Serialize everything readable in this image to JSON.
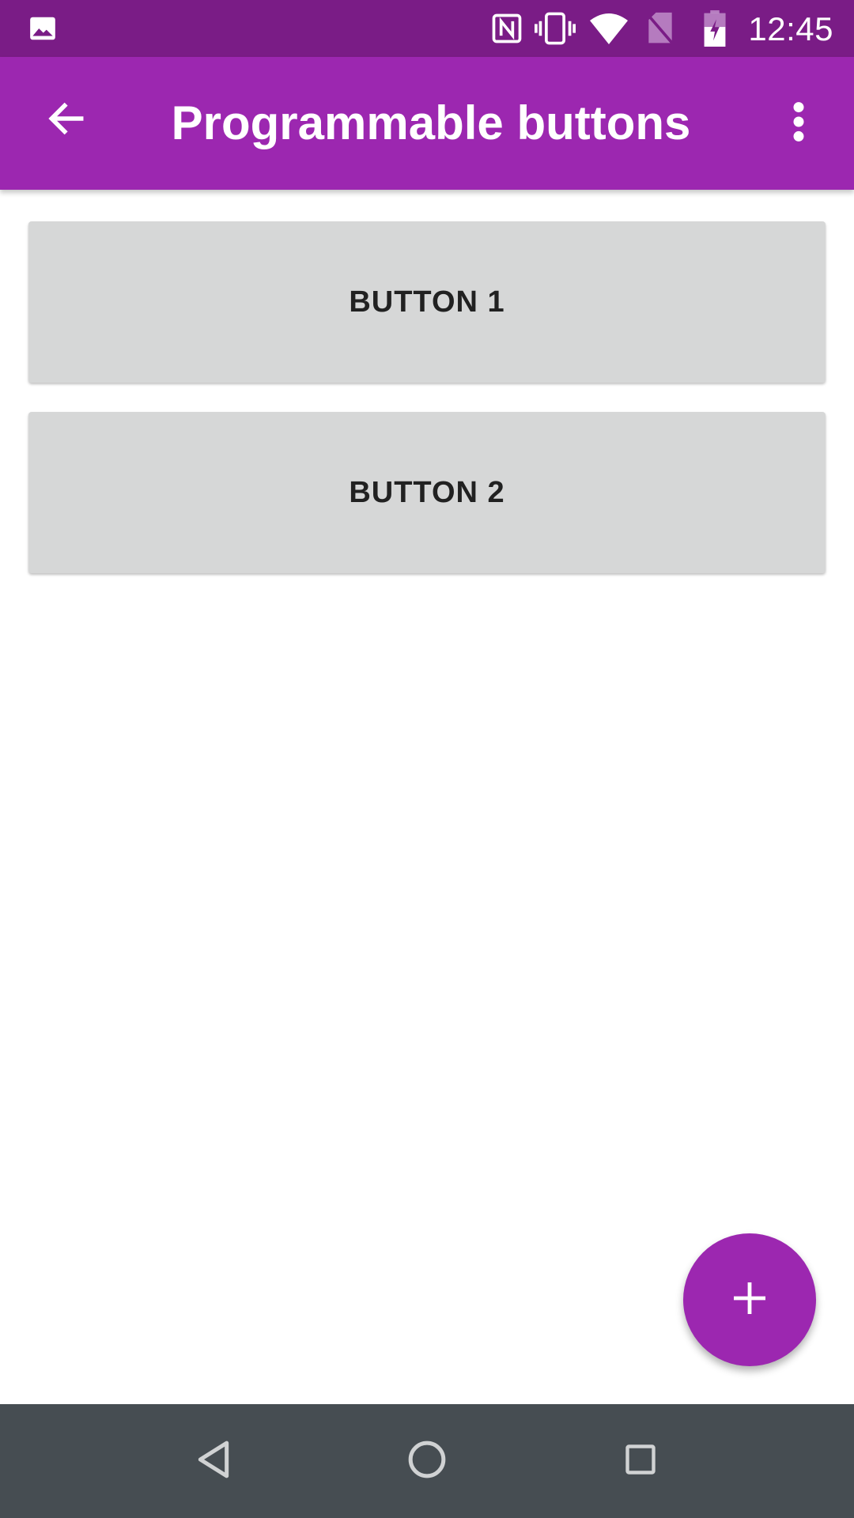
{
  "status_bar": {
    "time": "12:45",
    "icons": [
      "gallery-icon",
      "nfc-icon",
      "vibrate-icon",
      "wifi-icon",
      "no-sim-icon",
      "battery-charging-icon"
    ]
  },
  "app_bar": {
    "title": "Programmable buttons",
    "back_icon": "arrow-back-icon",
    "menu_icon": "more-vert-icon"
  },
  "buttons": [
    {
      "label": "BUTTON 1"
    },
    {
      "label": "BUTTON 2"
    }
  ],
  "fab": {
    "icon": "plus-icon"
  },
  "nav_bar": {
    "icons": [
      "back-triangle-icon",
      "home-circle-icon",
      "recents-square-icon"
    ]
  },
  "colors": {
    "primary": "#9c27b0",
    "primary_dark": "#7a1c86",
    "button_bg": "#d6d7d7",
    "nav_bar": "#464d52"
  }
}
